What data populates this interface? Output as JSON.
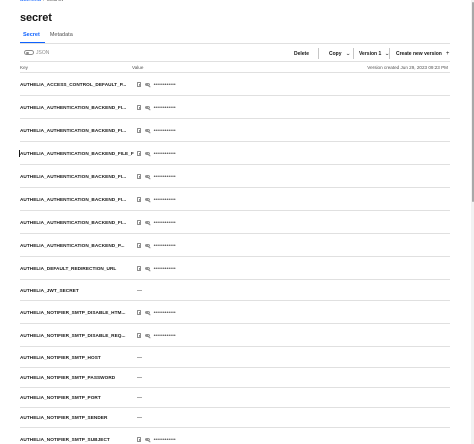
{
  "breadcrumb": {
    "parent": "authelia",
    "current": "secret"
  },
  "page_title": "secret",
  "tabs": [
    {
      "label": "Secret",
      "active": true
    },
    {
      "label": "Metadata",
      "active": false
    }
  ],
  "toolbar": {
    "toggle_label": "JSON",
    "delete_label": "Delete",
    "copy_label": "Copy",
    "version_label": "Version 1",
    "create_label": "Create new version"
  },
  "table": {
    "key_header": "Key",
    "value_header": "Value",
    "version_created": "Version created Jun 29, 2023 09:23 PM",
    "masked_text": "••••••••••••",
    "empty_text": "—",
    "rows": [
      {
        "key": "AUTHELIA_ACCESS_CONTROL_DEFAULT_P...",
        "masked": true
      },
      {
        "key": "AUTHELIA_AUTHENTICATION_BACKEND_FI...",
        "masked": true
      },
      {
        "key": "AUTHELIA_AUTHENTICATION_BACKEND_FI...",
        "masked": true
      },
      {
        "key": "AUTHELIA_AUTHENTICATION_BACKEND_FILE_F",
        "masked": true
      },
      {
        "key": "AUTHELIA_AUTHENTICATION_BACKEND_FI...",
        "masked": true
      },
      {
        "key": "AUTHELIA_AUTHENTICATION_BACKEND_FI...",
        "masked": true
      },
      {
        "key": "AUTHELIA_AUTHENTICATION_BACKEND_FI...",
        "masked": true
      },
      {
        "key": "AUTHELIA_AUTHENTICATION_BACKEND_P...",
        "masked": true
      },
      {
        "key": "AUTHELIA_DEFAULT_REDIRECTION_URL",
        "masked": true
      },
      {
        "key": "AUTHELIA_JWT_SECRET",
        "masked": false
      },
      {
        "key": "AUTHELIA_NOTIFIER_SMTP_DISABLE_HTM...",
        "masked": true
      },
      {
        "key": "AUTHELIA_NOTIFIER_SMTP_DISABLE_REQ...",
        "masked": true
      },
      {
        "key": "AUTHELIA_NOTIFIER_SMTP_HOST",
        "masked": false
      },
      {
        "key": "AUTHELIA_NOTIFIER_SMTP_PASSWORD",
        "masked": false
      },
      {
        "key": "AUTHELIA_NOTIFIER_SMTP_PORT",
        "masked": false
      },
      {
        "key": "AUTHELIA_NOTIFIER_SMTP_SENDER",
        "masked": false
      },
      {
        "key": "AUTHELIA_NOTIFIER_SMTP_SUBJECT",
        "masked": true
      }
    ]
  },
  "icons": {
    "copy": "copy-icon",
    "visibility": "eye-off-icon",
    "add": "add-icon",
    "dropdown": "chevron-down-icon"
  },
  "colors": {
    "accent": "#0f62fe",
    "border": "#e0e0e0",
    "muted": "#8d8d8d"
  }
}
